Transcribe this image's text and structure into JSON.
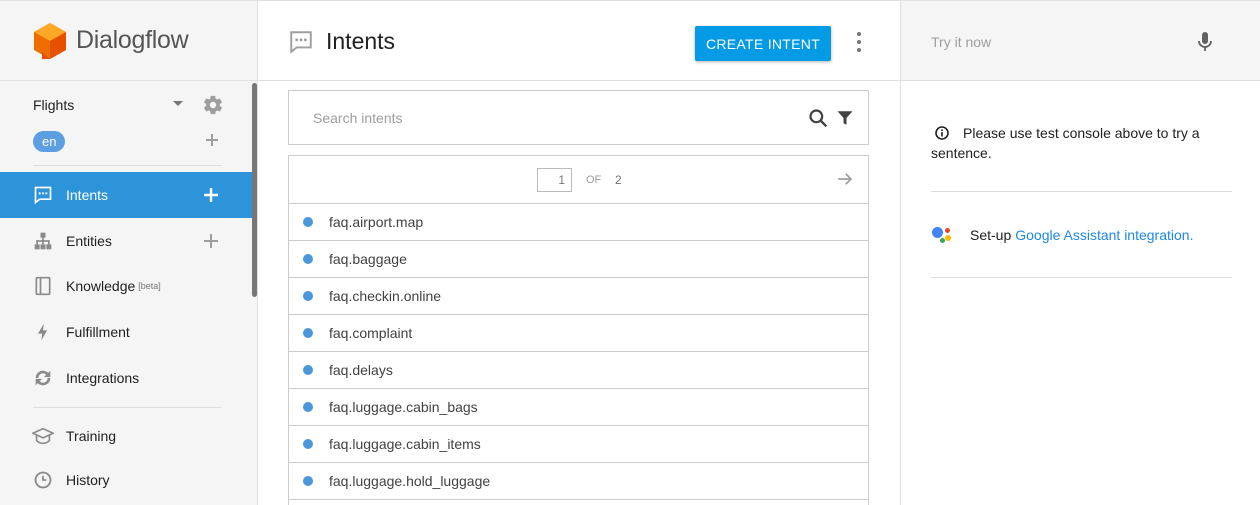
{
  "brand": {
    "name": "Dialogflow"
  },
  "agent": {
    "name": "Flights",
    "language": "en"
  },
  "sidebar": {
    "items": [
      {
        "label": "Intents",
        "active": true
      },
      {
        "label": "Entities"
      },
      {
        "label": "Knowledge",
        "badge": "[beta]"
      },
      {
        "label": "Fulfillment"
      },
      {
        "label": "Integrations"
      },
      {
        "label": "Training"
      },
      {
        "label": "History"
      }
    ]
  },
  "main": {
    "title": "Intents",
    "create_label": "CREATE INTENT",
    "search_placeholder": "Search intents",
    "pager": {
      "current": "1",
      "of_label": "OF",
      "total": "2"
    },
    "intents": [
      "faq.airport.map",
      "faq.baggage",
      "faq.checkin.online",
      "faq.complaint",
      "faq.delays",
      "faq.luggage.cabin_bags",
      "faq.luggage.cabin_items",
      "faq.luggage.hold_luggage"
    ]
  },
  "console": {
    "placeholder": "Try it now",
    "info_text": "Please use test console above to try a sentence.",
    "setup_prefix": "Set-up",
    "setup_link": "Google Assistant integration."
  },
  "colors": {
    "accent": "#2d94da",
    "button": "#039be5",
    "logo": "#ef6c00",
    "dot": "#4a97db"
  }
}
